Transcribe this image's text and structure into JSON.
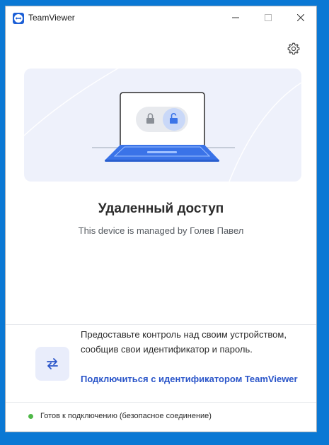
{
  "titlebar": {
    "title": "TeamViewer",
    "icons": {
      "logo": "teamviewer-logo",
      "minimize": "minimize-icon",
      "maximize": "maximize-icon",
      "close": "close-icon"
    }
  },
  "settings": {
    "icon": "gear-icon"
  },
  "hero": {
    "illustration": "laptop-with-lock-toggle",
    "icons": [
      "lock-closed-icon",
      "lock-open-icon"
    ]
  },
  "main": {
    "heading": "Удаленный доступ",
    "managed_text": "This device is managed by Голев Павел"
  },
  "connect": {
    "icon": "swap-arrows-icon",
    "description": "Предоставьте контроль над своим устройством, сообщив свои идентификатор и пароль.",
    "link": "Подключиться с идентификатором TeamViewer"
  },
  "status": {
    "text": "Готов к подключению (безопасное соединение)",
    "color": "#4fb848"
  },
  "colors": {
    "accent": "#2a55c9",
    "laptop_blue": "#3a73e8",
    "hero_bg": "#eef1fb"
  }
}
